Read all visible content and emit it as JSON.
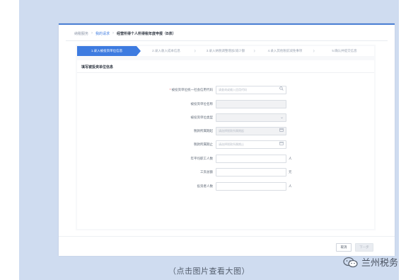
{
  "breadcrumb": {
    "items": [
      "纳税服务",
      "我的请求",
      "经营所得个人所得税年度申报（B表）"
    ]
  },
  "steps": [
    "1.录入被投资单位信息",
    "2.录入收入成本信息",
    "3.录入纳税调整增加/减少额",
    "4.录入其他税前减免事项",
    "5.确认并提交信息"
  ],
  "panel": {
    "title": "填写被投资单位信息"
  },
  "form": {
    "credit_code": {
      "label": "被投资单位统一社会信用代码",
      "required": true,
      "placeholder": "请查询或输入信用代码"
    },
    "unit_name": {
      "label": "被投资单位名称"
    },
    "unit_type": {
      "label": "被投资单位类型"
    },
    "period_start": {
      "label": "税款所属期起",
      "placeholder": "请选择税款所属期起"
    },
    "period_end": {
      "label": "税款所属期止",
      "placeholder": "请选择税款所属期止"
    },
    "employees": {
      "label": "年平均职工人数",
      "unit": "人"
    },
    "wages": {
      "label": "工资总额",
      "unit": "元"
    },
    "investors": {
      "label": "投资者人数",
      "unit": "人"
    }
  },
  "footer": {
    "cancel_label": "取消",
    "next_label": "下一步"
  },
  "caption": "（点击图片查看大图）",
  "brand": {
    "name": "兰州税务"
  },
  "colors": {
    "accent": "#3d7be0",
    "frame_bg": "#cfdcf0",
    "required": "#e5484d"
  }
}
